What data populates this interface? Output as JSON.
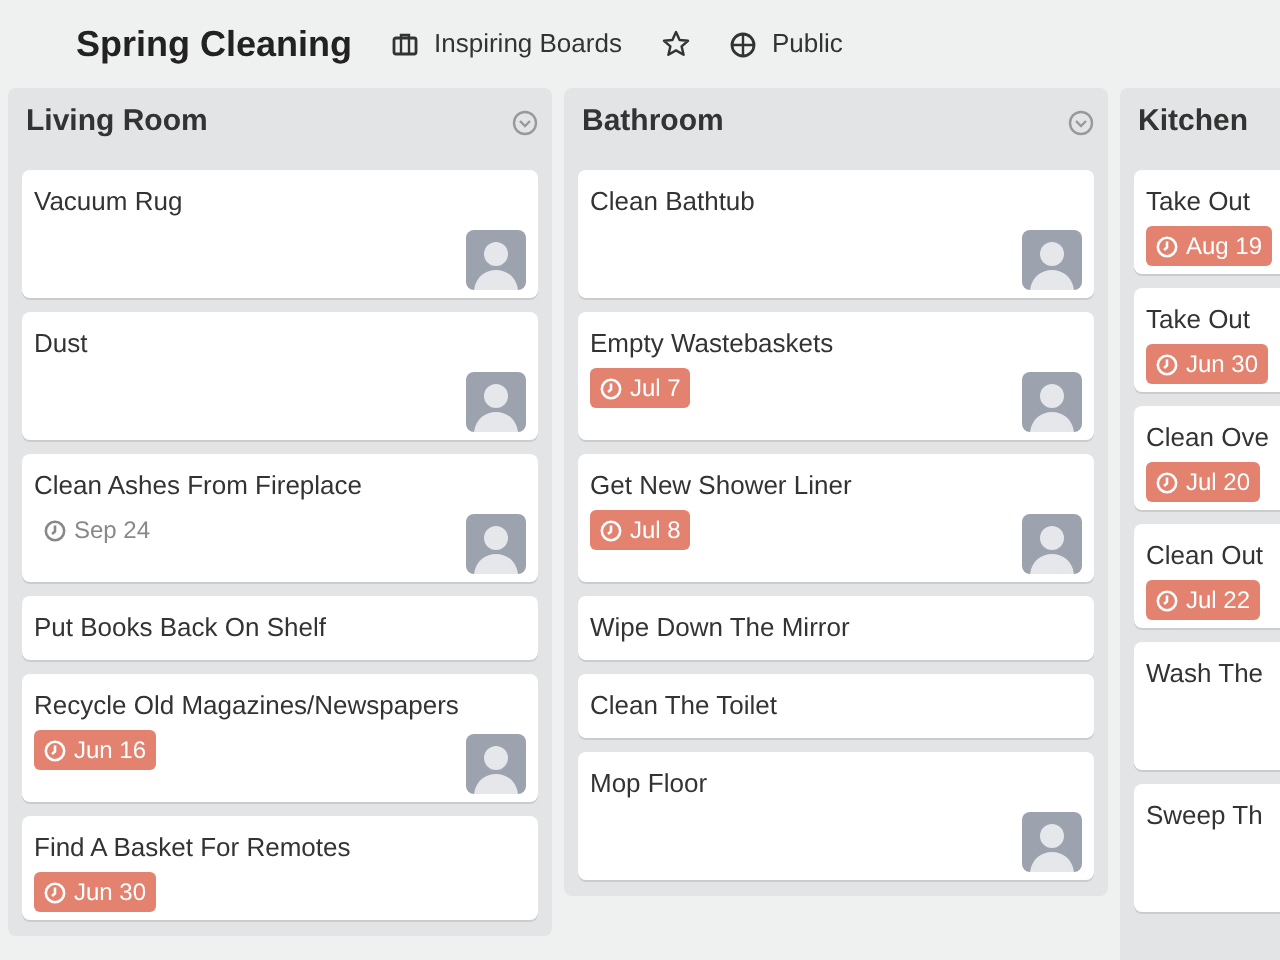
{
  "board": {
    "title": "Spring Cleaning",
    "team": "Inspiring Boards",
    "starred": false,
    "visibility": "Public"
  },
  "lists": [
    {
      "title": "Living Room",
      "cards": [
        {
          "title": "Vacuum Rug",
          "avatar": true
        },
        {
          "title": "Dust",
          "avatar": true
        },
        {
          "title": "Clean Ashes From Fireplace",
          "due": {
            "text": "Sep 24",
            "overdue": false
          },
          "avatar": true
        },
        {
          "title": "Put Books Back On Shelf",
          "avatar": false
        },
        {
          "title": "Recycle Old Magazines/Newspapers",
          "due": {
            "text": "Jun 16",
            "overdue": true
          },
          "avatar": true
        },
        {
          "title": "Find A Basket For Remotes",
          "due": {
            "text": "Jun 30",
            "overdue": true
          },
          "avatar": false
        }
      ]
    },
    {
      "title": "Bathroom",
      "cards": [
        {
          "title": "Clean Bathtub",
          "avatar": true
        },
        {
          "title": "Empty Wastebaskets",
          "due": {
            "text": "Jul 7",
            "overdue": true
          },
          "avatar": true
        },
        {
          "title": "Get New Shower Liner",
          "due": {
            "text": "Jul 8",
            "overdue": true
          },
          "avatar": true
        },
        {
          "title": "Wipe Down The Mirror",
          "avatar": false
        },
        {
          "title": "Clean The Toilet",
          "avatar": false
        },
        {
          "title": "Mop Floor",
          "avatar": true
        }
      ]
    },
    {
      "title": "Kitchen",
      "cards": [
        {
          "title": "Take Out",
          "due": {
            "text": "Aug 19",
            "overdue": true
          },
          "avatar": false
        },
        {
          "title": "Take Out",
          "due": {
            "text": "Jun 30",
            "overdue": true
          },
          "avatar": false
        },
        {
          "title": "Clean Ove",
          "due": {
            "text": "Jul 20",
            "overdue": true
          },
          "avatar": false
        },
        {
          "title": "Clean Out",
          "due": {
            "text": "Jul 22",
            "overdue": true
          },
          "avatar": false
        },
        {
          "title": "Wash The",
          "avatar": false,
          "tall": true
        },
        {
          "title": "Sweep Th",
          "avatar": false,
          "tall": true
        }
      ]
    }
  ]
}
